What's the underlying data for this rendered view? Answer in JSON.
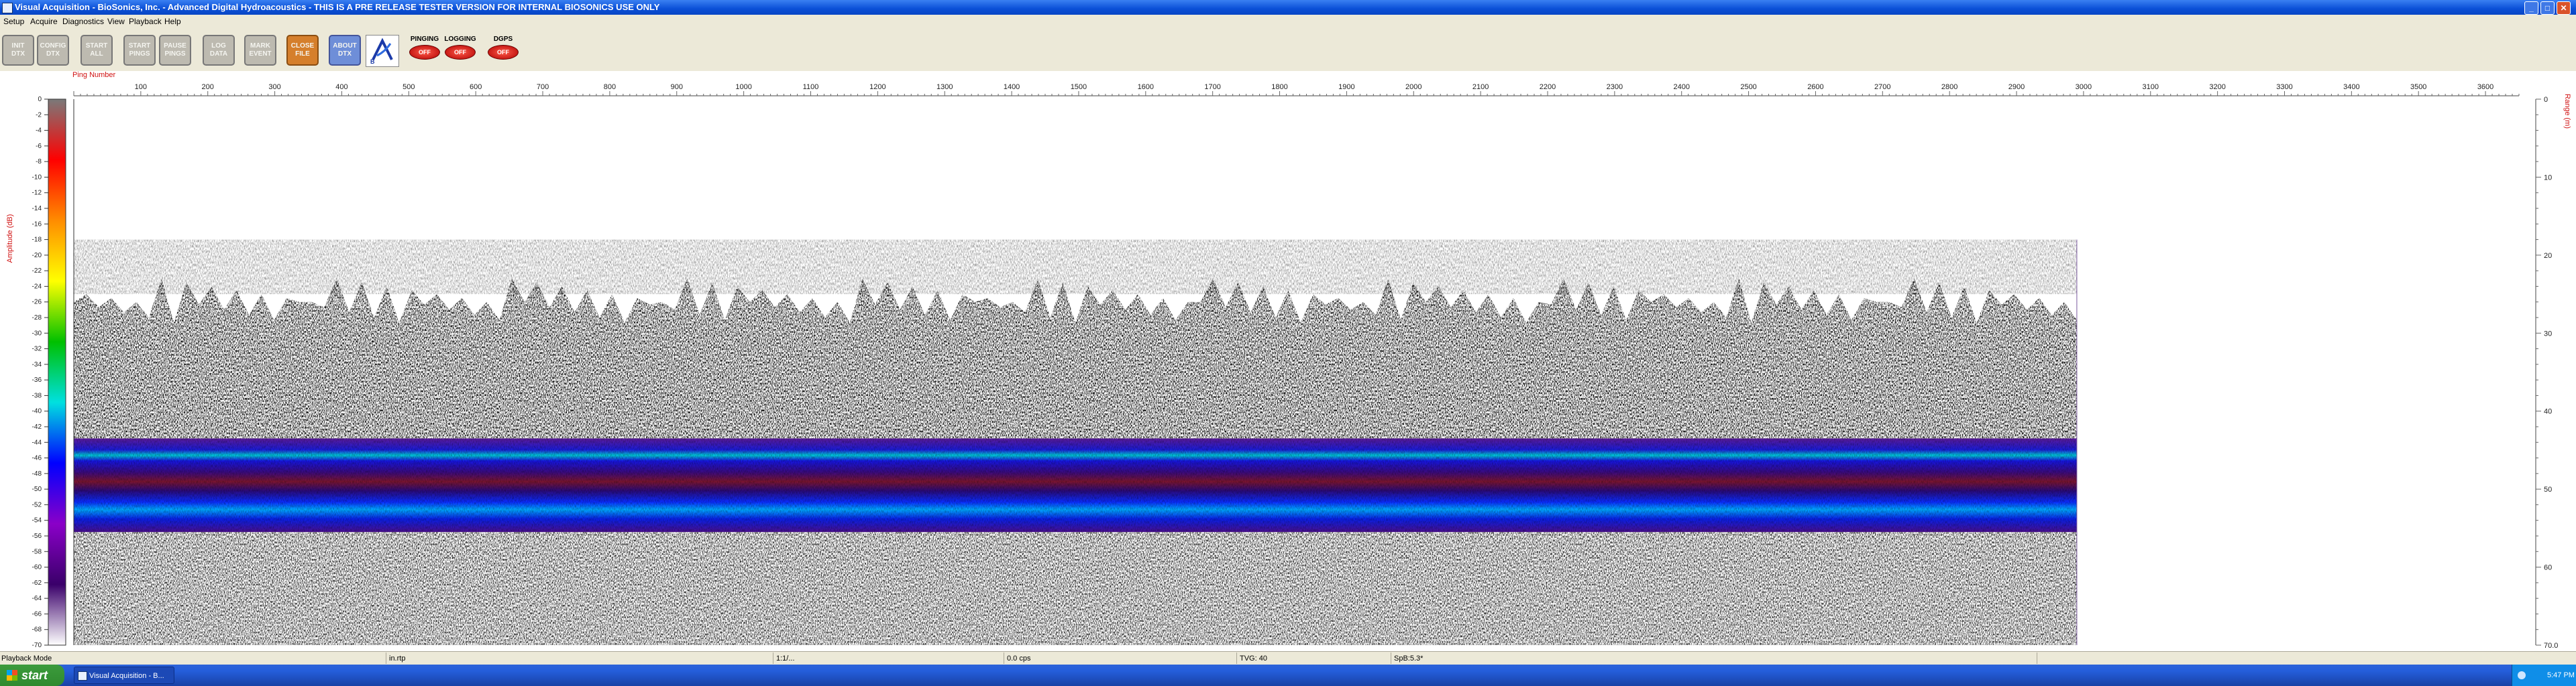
{
  "window": {
    "title": "Visual Acquisition  -  BioSonics, Inc.  -  Advanced Digital Hydroacoustics  -  THIS IS A PRE RELEASE TESTER VERSION FOR INTERNAL BIOSONICS USE ONLY",
    "minimize": "_",
    "maximize": "□",
    "close": "✕"
  },
  "menu": [
    "Setup",
    "Acquire",
    "Diagnostics",
    "View",
    "Playback",
    "Help"
  ],
  "toolbar": {
    "buttons": [
      {
        "label1": "INIT",
        "label2": "DTX",
        "style": "gray"
      },
      {
        "label1": "CONFIG",
        "label2": "DTX",
        "style": "gray"
      },
      {
        "label1": "START",
        "label2": "ALL",
        "style": "gray"
      },
      {
        "label1": "START",
        "label2": "PINGS",
        "style": "gray"
      },
      {
        "label1": "PAUSE",
        "label2": "PINGS",
        "style": "gray"
      },
      {
        "label1": "LOG",
        "label2": "DATA",
        "style": "gray"
      },
      {
        "label1": "MARK",
        "label2": "EVENT",
        "style": "gray"
      },
      {
        "label1": "CLOSE",
        "label2": "FILE",
        "style": "orange"
      },
      {
        "label1": "ABOUT",
        "label2": "DTX",
        "style": "blue"
      }
    ],
    "indicators": [
      {
        "label": "PINGING",
        "state": "OFF"
      },
      {
        "label": "LOGGING",
        "state": "OFF"
      },
      {
        "label": "DGPS",
        "state": "OFF"
      }
    ],
    "logo_icon": "biosonics-logo-icon"
  },
  "echogram": {
    "x_axis_title": "Ping Number",
    "x_ticks": [
      100,
      200,
      300,
      400,
      500,
      600,
      700,
      800,
      900,
      1000,
      1100,
      1200,
      1300,
      1400,
      1500,
      1600,
      1700,
      1800,
      1900,
      2000,
      2100,
      2200,
      2300,
      2400,
      2500,
      2600,
      2700,
      2800,
      2900,
      3000,
      3100,
      3200,
      3300,
      3400,
      3500,
      3600
    ],
    "x_range": [
      0,
      3650
    ],
    "data_extent_pings": 2990,
    "colorbar_title": "Amplitude (dB)",
    "colorbar_ticks": [
      0,
      -2,
      -4,
      -6,
      -8,
      -10,
      -12,
      -14,
      -16,
      -18,
      -20,
      -22,
      -24,
      -26,
      -28,
      -30,
      -32,
      -34,
      -36,
      -38,
      -40,
      -42,
      -44,
      -46,
      -48,
      -50,
      -52,
      -54,
      -56,
      -58,
      -60,
      -62,
      -64,
      -66,
      -68,
      -70
    ],
    "colorbar_range": [
      0,
      -70
    ],
    "colorbar_colors": [
      "#7a7a7a",
      "#ff0000",
      "#ff8c00",
      "#ffff00",
      "#00c000",
      "#00e0e0",
      "#0000ff",
      "#8a00c8",
      "#3a006a",
      "#ffffff"
    ],
    "range_axis_title": "Range (m)",
    "range_ticks": [
      "0",
      "10",
      "20",
      "30",
      "40",
      "50",
      "60",
      "70.0"
    ],
    "range_extent": [
      0,
      70
    ]
  },
  "status": {
    "mode": "Playback Mode",
    "file": "in.rtp",
    "ratio": "1:1/...",
    "rate": "0.0 cps",
    "tvg": "TVG: 40",
    "spb": "SpB:5.3*"
  },
  "taskbar": {
    "start": "start",
    "task": "Visual Acquisition  -  B...",
    "clock": "5:47 PM"
  }
}
